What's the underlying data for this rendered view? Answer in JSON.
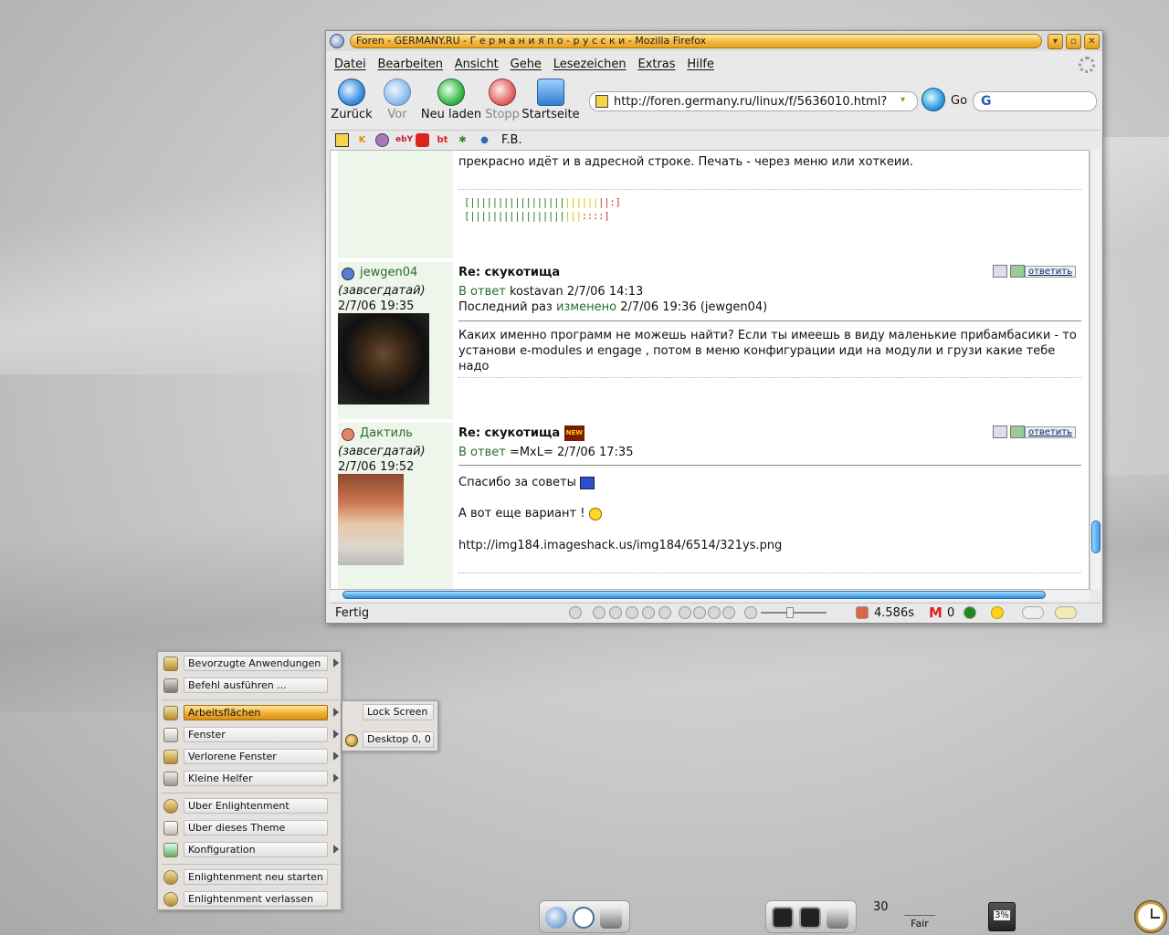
{
  "window": {
    "title": "Foren - GERMANY.RU - Г е р м а н и я п о - р у с с к и - Mozilla Firefox",
    "menu": [
      "Datei",
      "Bearbeiten",
      "Ansicht",
      "Gehe",
      "Lesezeichen",
      "Extras",
      "Hilfe"
    ],
    "nav": {
      "back": "Zurück",
      "forward": "Vor",
      "reload": "Neu laden",
      "stop": "Stopp",
      "home": "Startseite"
    },
    "url": "http://foren.germany.ru/linux/f/5636010.html?",
    "go_label": "Go",
    "search_logo": "G",
    "bookmarks": [
      "K",
      "ebY",
      "bt",
      "F.B."
    ],
    "status": "Fertig",
    "timer": "4.586s",
    "gmail_icon": "M",
    "gmail_count": "0"
  },
  "page": {
    "fragment_text": "прекрасно идёт и в адресной строке. Печать - через меню или хоткеии.",
    "bars": {
      "row1": {
        "green": "[|||||||||||||||||",
        "yellow": "||||||",
        "red": "||:]"
      },
      "row2": {
        "green": "[|||||||||||||||||",
        "yellow": "|||",
        "red": "::::]"
      }
    },
    "posts": [
      {
        "user": "jewgen04",
        "rank": "(завсегдатай)",
        "date": "2/7/06 19:35",
        "subject": "Re: скукотища",
        "reply_prefix": "В ответ",
        "reply_rest": "kostavan 2/7/06 14:13",
        "edited_prefix": "Последний раз",
        "edited_link": "изменено",
        "edited_rest": "2/7/06 19:36 (jewgen04)",
        "body_line1": "Каких именно программ не можешь найти? Если ты имеешь в виду маленькие прибамбасики - то",
        "body_line2": "установи e-modules и engage , потом в меню конфигурации иди на модули и грузи какие тебе надо",
        "reply_button": "ответить"
      },
      {
        "user": "Дактиль",
        "rank": "(завсегдатай)",
        "date": "2/7/06 19:52",
        "subject": "Re: скукотища",
        "new_badge": "NEW",
        "reply_prefix": "В ответ",
        "reply_rest": "=MxL= 2/7/06 17:35",
        "body_line1": "Спасибо за советы",
        "body_line2": "А вот еще вариант !",
        "body_line3": "http://img184.imageshack.us/img184/6514/321ys.png",
        "reply_button": "ответить"
      }
    ]
  },
  "emenu": {
    "items": [
      "Bevorzugte Anwendungen",
      "Befehl ausführen ...",
      "Arbeitsflächen",
      "Fenster",
      "Verlorene Fenster",
      "Kleine Helfer",
      "Uber Enlightenment",
      "Uber dieses Theme",
      "Konfiguration",
      "Enlightenment neu starten",
      "Enlightenment verlassen"
    ],
    "submenu": [
      "Lock Screen",
      "Desktop 0, 0"
    ]
  },
  "shelf": {
    "pager": "30",
    "weather": "Fair",
    "battery": "3%"
  },
  "colors": {
    "accent_orange": "#f1ae2e",
    "link_green": "#2a6a2a",
    "scroll_blue": "#2d8fde"
  }
}
